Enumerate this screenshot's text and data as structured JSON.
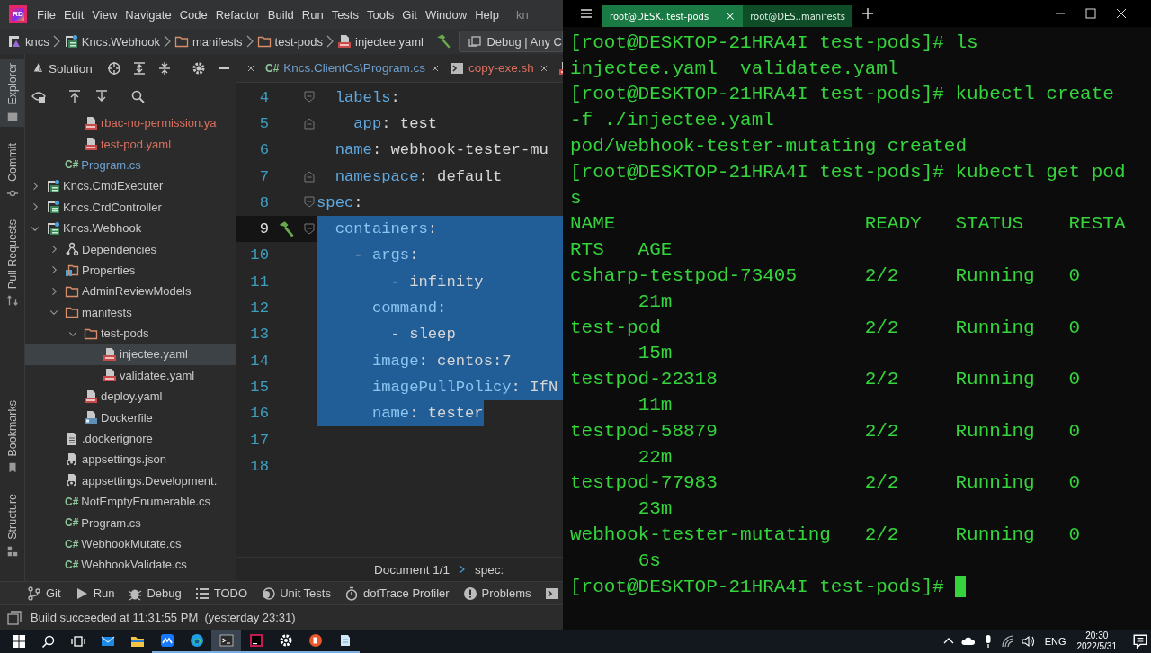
{
  "ide": {
    "logo": "RD",
    "menu": [
      "File",
      "Edit",
      "View",
      "Navigate",
      "Code",
      "Refactor",
      "Build",
      "Run",
      "Tests",
      "Tools",
      "Git",
      "Window",
      "Help"
    ],
    "title_fragment": "kn",
    "breadcrumb": [
      {
        "label": "kncs",
        "kind": "solution"
      },
      {
        "label": "Kncs.Webhook",
        "kind": "project"
      },
      {
        "label": "manifests",
        "kind": "folder"
      },
      {
        "label": "test-pods",
        "kind": "folder"
      },
      {
        "label": "injectee.yaml",
        "kind": "yaml"
      }
    ],
    "run_config": "Debug | Any C",
    "side_strip": [
      {
        "label": "Explorer",
        "selected": true
      },
      {
        "label": "Commit",
        "selected": false
      },
      {
        "label": "Pull Requests",
        "selected": false
      },
      {
        "label": "Bookmarks",
        "selected": false
      },
      {
        "label": "Structure",
        "selected": false
      }
    ],
    "solution_panel": {
      "title": "Solution",
      "tree": [
        {
          "children": [
            {
              "children": [
                {
                  "label": "rbac-no-permission.ya",
                  "kind": "yaml",
                  "color": "#d8705f",
                  "selected": false
                },
                {
                  "label": "test-pod.yaml",
                  "kind": "yaml",
                  "color": "#d8705f",
                  "selected": false
                }
              ]
            },
            {
              "label": "Program.cs",
              "kind": "csharp",
              "badge": "C#",
              "color": "#6e9fcd",
              "selected": false
            }
          ]
        },
        {
          "label": "Kncs.CmdExecuter",
          "kind": "project",
          "expanded": false,
          "selected": false
        },
        {
          "label": "Kncs.CrdController",
          "kind": "project",
          "expanded": false,
          "selected": false
        },
        {
          "label": "Kncs.Webhook",
          "kind": "project",
          "expanded": true,
          "selected": false,
          "children": [
            {
              "label": "Dependencies",
              "kind": "dependencies",
              "expanded": false,
              "selected": false
            },
            {
              "label": "Properties",
              "kind": "properties",
              "expanded": false,
              "selected": false
            },
            {
              "label": "AdminReviewModels",
              "kind": "folder",
              "expanded": false,
              "selected": false
            },
            {
              "label": "manifests",
              "kind": "folder",
              "expanded": true,
              "selected": false,
              "children": [
                {
                  "label": "test-pods",
                  "kind": "folder",
                  "expanded": true,
                  "selected": false,
                  "children": [
                    {
                      "label": "injectee.yaml",
                      "kind": "yaml",
                      "selected": true
                    },
                    {
                      "label": "validatee.yaml",
                      "kind": "yaml",
                      "selected": false
                    }
                  ]
                },
                {
                  "label": "deploy.yaml",
                  "kind": "yaml",
                  "selected": false
                },
                {
                  "label": "Dockerfile",
                  "kind": "docker",
                  "selected": false
                }
              ]
            },
            {
              "label": ".dockerignore",
              "kind": "text",
              "selected": false
            },
            {
              "label": "appsettings.json",
              "kind": "json",
              "selected": false
            },
            {
              "label": "appsettings.Development.",
              "kind": "json",
              "selected": false
            },
            {
              "label": "NotEmptyEnumerable.cs",
              "kind": "csharp",
              "badge": "C#",
              "selected": false
            },
            {
              "label": "Program.cs",
              "kind": "csharp",
              "badge": "C#",
              "selected": false
            },
            {
              "label": "WebhookMutate.cs",
              "kind": "csharp",
              "badge": "C#",
              "selected": false
            },
            {
              "label": "WebhookValidate.cs",
              "kind": "csharp",
              "badge": "C#",
              "selected": false
            }
          ]
        }
      ]
    },
    "editor": {
      "tabs": [
        {
          "label": "Kncs.ClientCs\\Program.cs",
          "kind": "csharp",
          "badge": "C#",
          "color": "#6e9fcd",
          "selected": false
        },
        {
          "label": "copy-exe.sh",
          "kind": "shell",
          "color": "#d8705f",
          "selected": false
        },
        {
          "kind": "yaml",
          "selected": false
        }
      ],
      "lines": [
        {
          "number": "4",
          "tokens": [
            {
              "kind": "key",
              "text": "  labels"
            },
            {
              "kind": "punct",
              "text": ":"
            }
          ],
          "fold_start": true,
          "current": false,
          "selected": false
        },
        {
          "number": "5",
          "tokens": [
            {
              "kind": "key",
              "text": "    app"
            },
            {
              "kind": "punct",
              "text": ": "
            },
            {
              "kind": "value",
              "text": "test"
            }
          ],
          "fold_end": true,
          "current": false,
          "selected": false
        },
        {
          "number": "6",
          "tokens": [
            {
              "kind": "key",
              "text": "  name"
            },
            {
              "kind": "punct",
              "text": ": "
            },
            {
              "kind": "value",
              "text": "webhook-tester-mu"
            }
          ],
          "current": false,
          "selected": false
        },
        {
          "number": "7",
          "tokens": [
            {
              "kind": "key",
              "text": "  namespace"
            },
            {
              "kind": "punct",
              "text": ": "
            },
            {
              "kind": "value",
              "text": "default"
            }
          ],
          "fold_end": true,
          "current": false,
          "selected": false
        },
        {
          "number": "8",
          "tokens": [
            {
              "kind": "key",
              "text": "spec"
            },
            {
              "kind": "punct",
              "text": ":"
            }
          ],
          "fold_start": true,
          "current": false,
          "selected": false
        },
        {
          "number": "9",
          "tokens": [
            {
              "kind": "key",
              "text": "  containers"
            },
            {
              "kind": "punct",
              "text": ":"
            }
          ],
          "fold_start": true,
          "build_marker": true,
          "current": true,
          "selected": true,
          "newline_selected": true
        },
        {
          "number": "10",
          "tokens": [
            {
              "kind": "punct",
              "text": "    - "
            },
            {
              "kind": "key",
              "text": "args"
            },
            {
              "kind": "punct",
              "text": ":"
            }
          ],
          "current": false,
          "selected": true,
          "newline_selected": true
        },
        {
          "number": "11",
          "tokens": [
            {
              "kind": "punct",
              "text": "        - "
            },
            {
              "kind": "value",
              "text": "infinity"
            }
          ],
          "current": false,
          "selected": true,
          "newline_selected": true
        },
        {
          "number": "12",
          "tokens": [
            {
              "kind": "key",
              "text": "      command"
            },
            {
              "kind": "punct",
              "text": ":"
            }
          ],
          "current": false,
          "selected": true,
          "newline_selected": true
        },
        {
          "number": "13",
          "tokens": [
            {
              "kind": "punct",
              "text": "        - "
            },
            {
              "kind": "value",
              "text": "sleep"
            }
          ],
          "current": false,
          "selected": true,
          "newline_selected": true
        },
        {
          "number": "14",
          "tokens": [
            {
              "kind": "key",
              "text": "      image"
            },
            {
              "kind": "punct",
              "text": ": "
            },
            {
              "kind": "value",
              "text": "centos:7"
            }
          ],
          "current": false,
          "selected": true,
          "newline_selected": true
        },
        {
          "number": "15",
          "tokens": [
            {
              "kind": "key",
              "text": "      imagePullPolicy"
            },
            {
              "kind": "punct",
              "text": ": "
            },
            {
              "kind": "value",
              "text": "IfN"
            }
          ],
          "current": false,
          "selected": true,
          "newline_selected": true
        },
        {
          "number": "16",
          "tokens": [
            {
              "kind": "key",
              "text": "      name"
            },
            {
              "kind": "punct",
              "text": ": "
            },
            {
              "kind": "value",
              "text": "tester"
            }
          ],
          "current": false,
          "selected": true,
          "newline_selected": false
        },
        {
          "number": "17",
          "current": false,
          "selected": false
        },
        {
          "number": "18",
          "current": false,
          "selected": false
        }
      ],
      "breadcrumb": [
        "Document 1/1",
        "spec:"
      ]
    },
    "tool_windows": [
      {
        "label": "Git",
        "kind": "git"
      },
      {
        "label": "Run",
        "kind": "run"
      },
      {
        "label": "Debug",
        "kind": "debug"
      },
      {
        "label": "TODO",
        "kind": "todo"
      },
      {
        "label": "Unit Tests",
        "kind": "tests"
      },
      {
        "label": "dotTrace Profiler",
        "kind": "profiler"
      },
      {
        "label": "Problems",
        "kind": "problems"
      },
      {
        "kind": "terminal"
      }
    ],
    "status_bar": "Build succeeded at 11:31:55 PM  (yesterday 23:31)"
  },
  "terminal": {
    "tabs": [
      {
        "label": "root@DESK..test-pods",
        "selected": true
      },
      {
        "label": "root@DES..manifests",
        "selected": false
      }
    ],
    "lines": [
      "[root@DESKTOP-21HRA4I test-pods]# ls",
      "injectee.yaml  validatee.yaml",
      "[root@DESKTOP-21HRA4I test-pods]# kubectl create",
      "-f ./injectee.yaml",
      "pod/webhook-tester-mutating created",
      "[root@DESKTOP-21HRA4I test-pods]# kubectl get pod",
      "s",
      "NAME                      READY   STATUS    RESTA",
      "RTS   AGE",
      "csharp-testpod-73405      2/2     Running   0",
      "      21m",
      "test-pod                  2/2     Running   0",
      "      15m",
      "testpod-22318             2/2     Running   0",
      "      11m",
      "testpod-58879             2/2     Running   0",
      "      22m",
      "testpod-77983             2/2     Running   0",
      "      23m",
      "webhook-tester-mutating   2/2     Running   0",
      "      6s",
      "[root@DESKTOP-21HRA4I test-pods]# "
    ],
    "cursor": true
  },
  "taskbar": {
    "apps": [
      {
        "kind": "start",
        "running": false,
        "selected": false
      },
      {
        "kind": "search",
        "running": false,
        "selected": false
      },
      {
        "kind": "taskview",
        "running": false,
        "selected": false
      },
      {
        "kind": "mail",
        "running": false,
        "selected": false
      },
      {
        "kind": "explorer",
        "running": false,
        "selected": false
      },
      {
        "kind": "meeting",
        "running": true,
        "selected": false
      },
      {
        "kind": "edge",
        "running": true,
        "selected": false
      },
      {
        "kind": "terminal",
        "running": true,
        "selected": true
      },
      {
        "kind": "rider",
        "running": true,
        "selected": false
      },
      {
        "kind": "settings",
        "running": true,
        "selected": false
      },
      {
        "kind": "powerpoint",
        "running": true,
        "selected": false
      },
      {
        "kind": "notepad",
        "running": true,
        "selected": false
      }
    ],
    "tray": {
      "language": "ENG",
      "time": "20:30",
      "date": "2022/5/31"
    }
  }
}
